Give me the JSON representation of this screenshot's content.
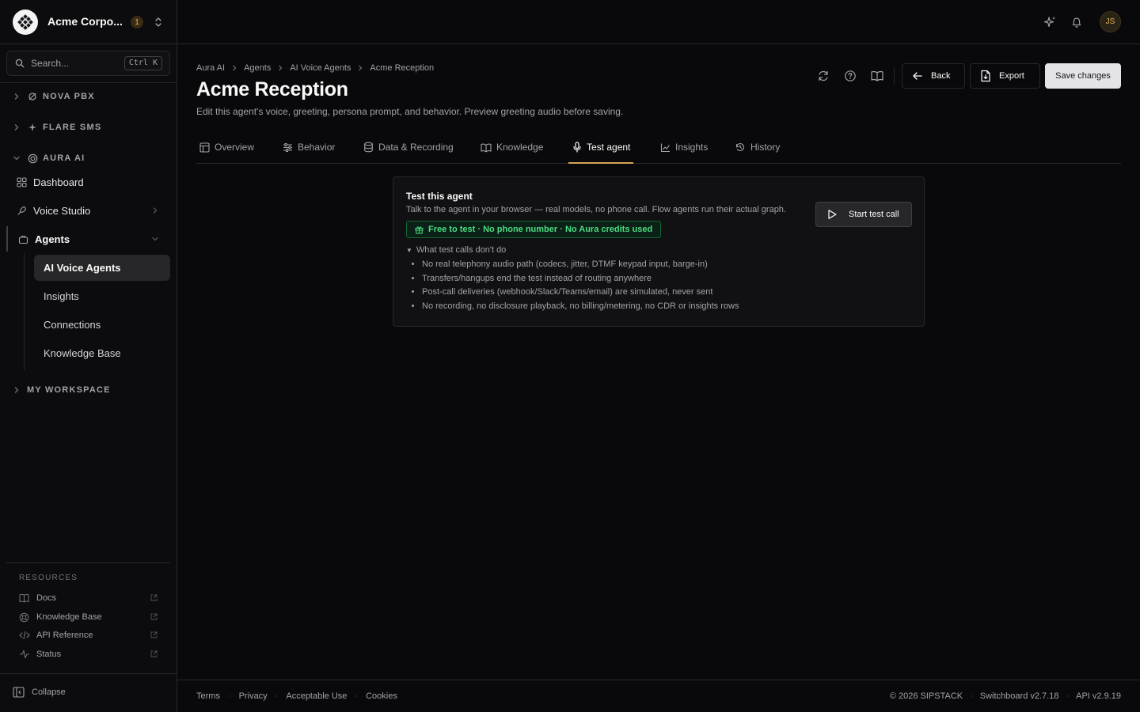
{
  "org": {
    "name": "Acme Corpo...",
    "notification_count": "1"
  },
  "search": {
    "placeholder": "Search...",
    "shortcut": "Ctrl K"
  },
  "sidebar": {
    "groups": [
      {
        "label": "NOVA PBX",
        "icon": "pbx-icon",
        "expanded": false
      },
      {
        "label": "FLARE SMS",
        "icon": "sparkle-icon",
        "expanded": false
      },
      {
        "label": "AURA AI",
        "icon": "aura-icon",
        "expanded": true
      },
      {
        "label": "MY WORKSPACE",
        "expanded": false
      }
    ],
    "nav": [
      {
        "label": "Dashboard",
        "icon": "dashboard-icon"
      },
      {
        "label": "Voice Studio",
        "icon": "voice-studio-icon"
      },
      {
        "label": "Agents",
        "icon": "agents-icon"
      }
    ],
    "agents_sub": [
      {
        "label": "AI Voice Agents",
        "active": true
      },
      {
        "label": "Insights"
      },
      {
        "label": "Connections"
      },
      {
        "label": "Knowledge Base"
      }
    ],
    "resources_title": "RESOURCES",
    "resources": [
      {
        "label": "Docs",
        "icon": "book-icon"
      },
      {
        "label": "Knowledge Base",
        "icon": "lifebuoy-icon"
      },
      {
        "label": "API Reference",
        "icon": "code-icon"
      },
      {
        "label": "Status",
        "icon": "activity-icon"
      }
    ],
    "collapse_label": "Collapse"
  },
  "topbar": {
    "avatar_initials": "JS"
  },
  "breadcrumb": [
    "Aura AI",
    "Agents",
    "AI Voice Agents",
    "Acme Reception"
  ],
  "page": {
    "title": "Acme Reception",
    "subtitle": "Edit this agent's voice, greeting, persona prompt, and behavior. Preview greeting audio before saving."
  },
  "actions": {
    "back": "Back",
    "export": "Export",
    "save": "Save changes"
  },
  "tabs": [
    {
      "label": "Overview",
      "icon": "layout-icon"
    },
    {
      "label": "Behavior",
      "icon": "sliders-icon"
    },
    {
      "label": "Data & Recording",
      "icon": "database-icon"
    },
    {
      "label": "Knowledge",
      "icon": "book-icon"
    },
    {
      "label": "Test agent",
      "icon": "mic-icon",
      "active": true
    },
    {
      "label": "Insights",
      "icon": "chart-icon"
    },
    {
      "label": "History",
      "icon": "history-icon"
    }
  ],
  "test_card": {
    "title": "Test this agent",
    "description": "Talk to the agent in your browser — real models, no phone call. Flow agents run their actual graph.",
    "badge": "Free to test · No phone number · No Aura credits used",
    "start_button": "Start test call",
    "details_summary": "What test calls don't do",
    "limitations": [
      "No real telephony audio path (codecs, jitter, DTMF keypad input, barge-in)",
      "Transfers/hangups end the test instead of routing anywhere",
      "Post-call deliveries (webhook/Slack/Teams/email) are simulated, never sent",
      "No recording, no disclosure playback, no billing/metering, no CDR or insights rows"
    ]
  },
  "footer": {
    "links": [
      "Terms",
      "Privacy",
      "Acceptable Use",
      "Cookies"
    ],
    "copyright": "© 2026 SIPSTACK",
    "switchboard_version": "Switchboard v2.7.18",
    "api_version": "API v2.9.19"
  },
  "colors": {
    "accent": "#d6a34f",
    "success": "#4ade80",
    "background": "#09090b"
  }
}
